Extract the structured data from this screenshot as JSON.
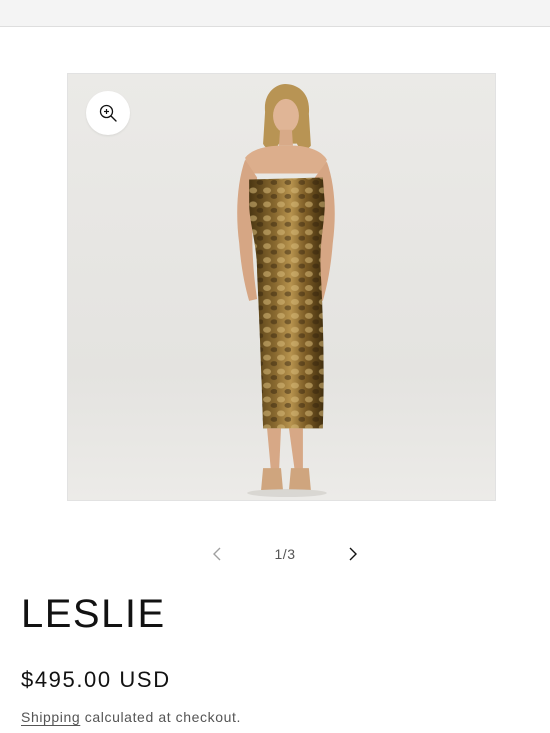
{
  "colors": {
    "photo_background": "#e6e5e2",
    "dress": "#6b5124",
    "text": "#121212",
    "muted_text": "#555555"
  },
  "media": {
    "zoom_icon": "zoom-in-icon",
    "counter": "1/3",
    "prev_icon": "chevron-left-icon",
    "next_icon": "chevron-right-icon"
  },
  "product": {
    "title": "LESLIE",
    "price": "$495.00 USD"
  },
  "shipping": {
    "link_label": "Shipping",
    "note": " calculated at checkout."
  }
}
